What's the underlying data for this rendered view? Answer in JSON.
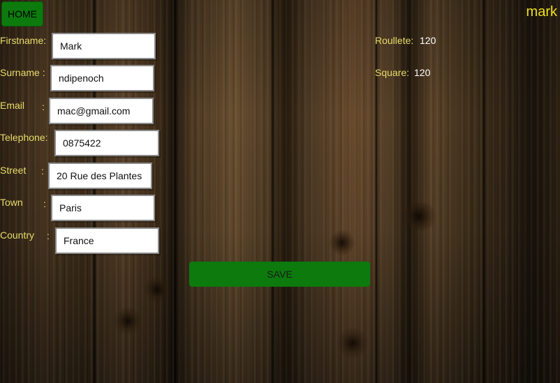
{
  "header": {
    "home_label": "HOME",
    "username": "mark"
  },
  "form": {
    "firstname": {
      "label": "Firstname:",
      "colon": "",
      "value": "Mark"
    },
    "surname": {
      "label": "Surname :",
      "colon": "",
      "value": "ndipenoch"
    },
    "email": {
      "label": "Email",
      "colon": ":",
      "value": "mac@gmail.com"
    },
    "telephone": {
      "label": "Telephone:",
      "colon": "",
      "value": "0875422"
    },
    "street": {
      "label": "Street",
      "colon": ":",
      "value": "20 Rue des Plantes"
    },
    "town": {
      "label": "Town",
      "colon": ":",
      "value": "Paris"
    },
    "country": {
      "label": "Country",
      "colon": ":",
      "value": "France"
    }
  },
  "scores": {
    "roulette": {
      "label": "Roullete:",
      "value": "120"
    },
    "square": {
      "label": "Square:",
      "value": "120"
    }
  },
  "actions": {
    "save_label": "SAVE"
  },
  "colors": {
    "button_green": "#0c7a0c",
    "label_yellow": "#e8dc6a",
    "username_yellow": "#f2e21a"
  }
}
